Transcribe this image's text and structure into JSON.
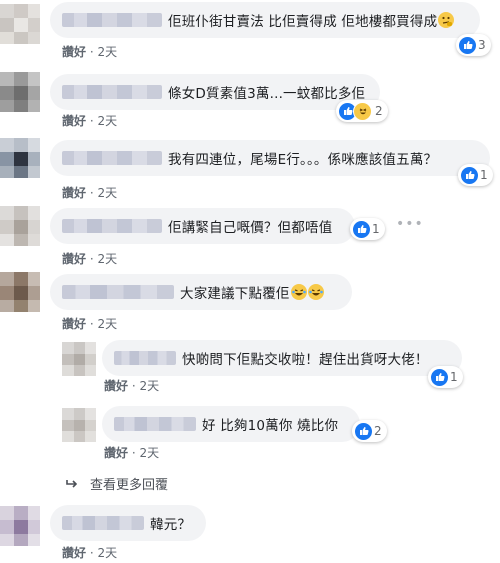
{
  "comments": [
    {
      "text": "佢班仆街甘賣法 比佢賣得成 佢地樓都買得成",
      "emoji": "thinking-emoji",
      "like_label": "讚好",
      "time": "2天",
      "reaction_count": "3",
      "reactions": [
        "like"
      ]
    },
    {
      "text": "條女D質素值3萬...一蚊都比多佢",
      "like_label": "讚好",
      "time": "2天",
      "reaction_count": "2",
      "reactions": [
        "like",
        "haha"
      ]
    },
    {
      "text": "我有四連位，尾場E行。。。係咪應該值五萬？",
      "like_label": "讚好",
      "time": "2天",
      "reaction_count": "1",
      "reactions": [
        "like"
      ]
    },
    {
      "text": "佢講緊自己嘅價？但都唔值",
      "like_label": "讚好",
      "time": "2天",
      "reaction_count": "1",
      "reactions": [
        "like"
      ]
    },
    {
      "text": "大家建議下點覆佢",
      "emoji": "laughing-emoji",
      "like_label": "讚好",
      "time": "2天",
      "reaction_count": "",
      "reactions": []
    }
  ],
  "replies": [
    {
      "text": "快啲問下佢點交收啦！趕住出貨呀大佬！",
      "like_label": "讚好",
      "time": "2天",
      "reaction_count": "1",
      "reactions": [
        "like"
      ]
    },
    {
      "text": "好 比夠10萬你 燒比你",
      "like_label": "讚好",
      "time": "2天",
      "reaction_count": "2",
      "reactions": [
        "like"
      ]
    }
  ],
  "view_more_label": "查看更多回覆",
  "last_comment": {
    "text": "韓元？",
    "like_label": "讚好",
    "time": "2天"
  },
  "colors": {
    "bubble": "#f2f3f5",
    "like_blue": "#1877f2",
    "meta_text": "#606770",
    "haha_yellow": "#f7c948"
  }
}
